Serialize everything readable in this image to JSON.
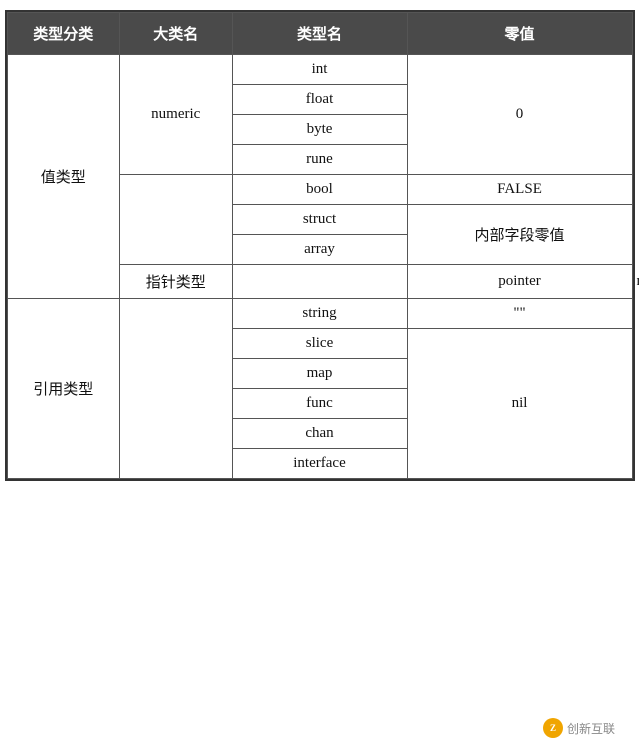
{
  "table": {
    "headers": [
      "类型分类",
      "大类名",
      "类型名",
      "零值"
    ],
    "sections": [
      {
        "category": "值类型",
        "category_rowspan": 8,
        "groups": [
          {
            "major": "numeric",
            "major_rowspan": 4,
            "types": [
              "int",
              "float",
              "byte",
              "rune"
            ],
            "zero": "0",
            "zero_rowspan": 4
          },
          {
            "major": "",
            "major_rowspan": 3,
            "types": [
              "bool",
              "struct",
              "array"
            ],
            "zeros": [
              "FALSE",
              "内部字段零值",
              "内部字段零值"
            ],
            "zero_special": true
          }
        ]
      },
      {
        "category": "指针类型",
        "category_rowspan": 1,
        "groups": [
          {
            "major": "",
            "major_rowspan": 1,
            "types": [
              "pointer"
            ],
            "zero": "nil",
            "zero_rowspan": 1
          }
        ]
      },
      {
        "category": "引用类型",
        "category_rowspan": 6,
        "groups": [
          {
            "major": "",
            "major_rowspan": 6,
            "types": [
              "string",
              "slice",
              "map",
              "func",
              "chan",
              "interface"
            ],
            "zeros": [
              "\"\"",
              "nil"
            ],
            "zero_special": true
          }
        ]
      }
    ],
    "watermark": "创新互联"
  }
}
